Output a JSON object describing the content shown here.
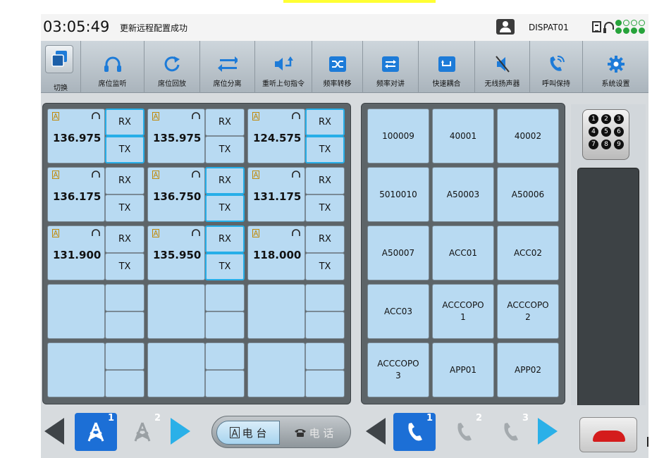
{
  "status": {
    "time": "03:05:49",
    "message": "更新远程配置成功",
    "user": "DISPAT01"
  },
  "toolbar": {
    "items": [
      {
        "label": "切换",
        "icon": "switch-icon"
      },
      {
        "label": "席位监听",
        "icon": "headset-icon"
      },
      {
        "label": "席位回放",
        "icon": "replay-icon"
      },
      {
        "label": "席位分离",
        "icon": "separate-icon"
      },
      {
        "label": "重听上句指令",
        "icon": "rehear-icon"
      },
      {
        "label": "频率转移",
        "icon": "frequency-transfer-icon"
      },
      {
        "label": "频率对讲",
        "icon": "frequency-intercom-icon"
      },
      {
        "label": "快速耦合",
        "icon": "quick-couple-icon"
      },
      {
        "label": "无线扬声器",
        "icon": "speaker-mute-icon"
      },
      {
        "label": "呼叫保持",
        "icon": "call-hold-icon"
      },
      {
        "label": "系统设置",
        "icon": "gear-icon"
      }
    ]
  },
  "radio": {
    "rx_label": "RX",
    "tx_label": "TX",
    "channels": [
      {
        "freq": "136.975",
        "rx_active": true,
        "tx_active": true
      },
      {
        "freq": "135.975",
        "rx_active": false,
        "tx_active": false
      },
      {
        "freq": "124.575",
        "rx_active": true,
        "tx_active": true
      },
      {
        "freq": "136.175",
        "rx_active": false,
        "tx_active": false
      },
      {
        "freq": "136.750",
        "rx_active": true,
        "tx_active": true
      },
      {
        "freq": "131.175",
        "rx_active": false,
        "tx_active": false
      },
      {
        "freq": "131.900",
        "rx_active": false,
        "tx_active": false
      },
      {
        "freq": "135.950",
        "rx_active": true,
        "tx_active": true
      },
      {
        "freq": "118.000",
        "rx_active": false,
        "tx_active": false
      }
    ]
  },
  "phone": {
    "contacts": [
      "100009",
      "40001",
      "40002",
      "5010010",
      "A50003",
      "A50006",
      "A50007",
      "ACC01",
      "ACC02",
      "ACC03",
      "ACCCOPO\n1",
      "ACCCOPO\n2",
      "ACCCOPO\n3",
      "APP01",
      "APP02"
    ]
  },
  "bottom": {
    "radio_pages": [
      "1",
      "2"
    ],
    "phone_pages": [
      "1",
      "2",
      "3"
    ],
    "mode_radio": "电 台",
    "mode_phone": "电 话"
  },
  "colors": {
    "cell": "#b8daf2",
    "highlight": "#26aee8",
    "accent_blue": "#1c6fd6",
    "hangup_red": "#d41c1c"
  }
}
